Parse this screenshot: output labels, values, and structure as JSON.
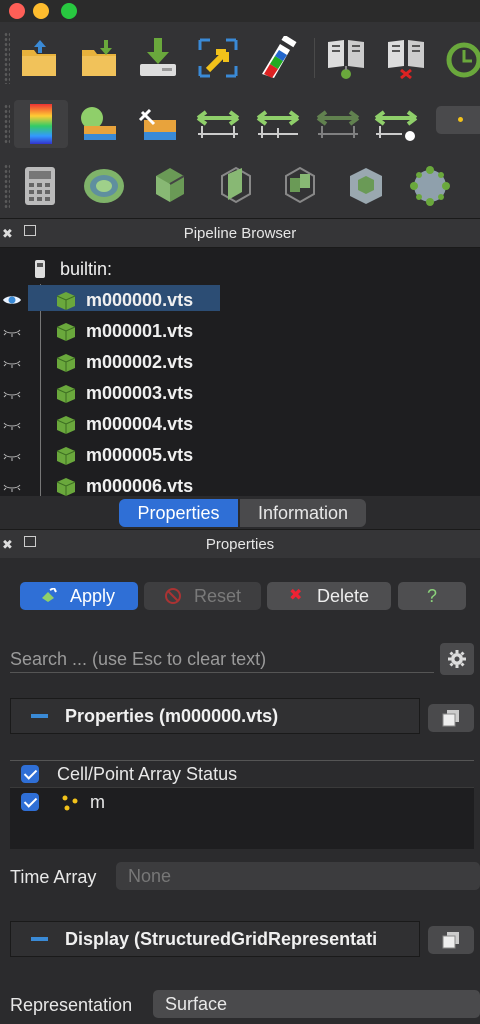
{
  "pipeline_browser": {
    "title": "Pipeline Browser",
    "root": "builtin:",
    "items": [
      {
        "label": "m000000.vts",
        "visible": true,
        "selected": true
      },
      {
        "label": "m000001.vts",
        "visible": false,
        "selected": false
      },
      {
        "label": "m000002.vts",
        "visible": false,
        "selected": false
      },
      {
        "label": "m000003.vts",
        "visible": false,
        "selected": false
      },
      {
        "label": "m000004.vts",
        "visible": false,
        "selected": false
      },
      {
        "label": "m000005.vts",
        "visible": false,
        "selected": false
      },
      {
        "label": "m000006.vts",
        "visible": false,
        "selected": false
      }
    ]
  },
  "tabs": {
    "properties": "Properties",
    "information": "Information"
  },
  "properties_panel": {
    "title": "Properties",
    "apply": "Apply",
    "reset": "Reset",
    "delete": "Delete",
    "help": "?",
    "search_placeholder": "Search ... (use Esc to clear text)",
    "properties_section": "Properties (m000000.vts)",
    "array_status_header": "Cell/Point Array Status",
    "array_item": "m",
    "time_array_label": "Time Array",
    "time_array_value": "None",
    "display_section": "Display (StructuredGridRepresentati",
    "representation_label": "Representation",
    "representation_value": "Surface"
  },
  "toolbar_icons": {
    "row1": [
      "open-icon",
      "save-data-icon",
      "download-icon",
      "zoom-to-data-icon",
      "python-icon",
      "connect-icon",
      "disconnect-icon",
      "reset-session-icon"
    ],
    "row2": [
      "color-legend-icon",
      "edit-color-map-icon",
      "rescale-custom-icon",
      "rescale-range-icon",
      "rescale-visible-icon",
      "rescale-temporal-icon",
      "rescale-all-icon"
    ],
    "row3": [
      "calculator-icon",
      "contour-icon",
      "clip-icon",
      "slice-icon",
      "threshold-icon",
      "extract-subset-icon",
      "glyph-icon"
    ]
  },
  "colors": {
    "accent": "#2f6fd6",
    "selected_row": "#2c4d74",
    "cube_green": "#6aa83c",
    "section_dash": "#3a8ad6"
  }
}
